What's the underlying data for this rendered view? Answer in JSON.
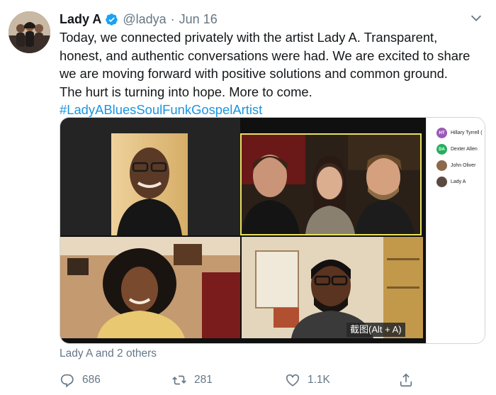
{
  "tweet": {
    "author_name": "Lady A",
    "handle": "@ladya",
    "separator": "·",
    "date": "Jun 16",
    "text_lines": [
      "Today, we connected privately with the artist Lady A. Transparent,",
      "honest, and authentic conversations were had. We are excited to share",
      "we are moving forward with positive solutions and common ground.",
      "The hurt is turning into hope. More to come."
    ],
    "hashtag": "#LadyABluesSoulFunkGospelArtist"
  },
  "media": {
    "participants": [
      {
        "initials": "HT",
        "name": "Hillary Tyrrell (",
        "color": "#9b59b6"
      },
      {
        "initials": "DA",
        "name": "Dexter Allen",
        "color": "#27ae60"
      },
      {
        "initials": "",
        "name": "John Oliver",
        "color": "#8a6a4a"
      },
      {
        "initials": "",
        "name": "Lady A",
        "color": "#5a4a40"
      }
    ],
    "screenshot_hint": "截图(Alt + A)"
  },
  "social_proof": "Lady A and 2 others",
  "actions": {
    "reply_count": "686",
    "retweet_count": "281",
    "like_count": "1.1K"
  },
  "colors": {
    "link": "#1b95e0",
    "secondary_text": "#657786",
    "verified": "#1da1f2",
    "active_tile_border": "#e8e060"
  }
}
